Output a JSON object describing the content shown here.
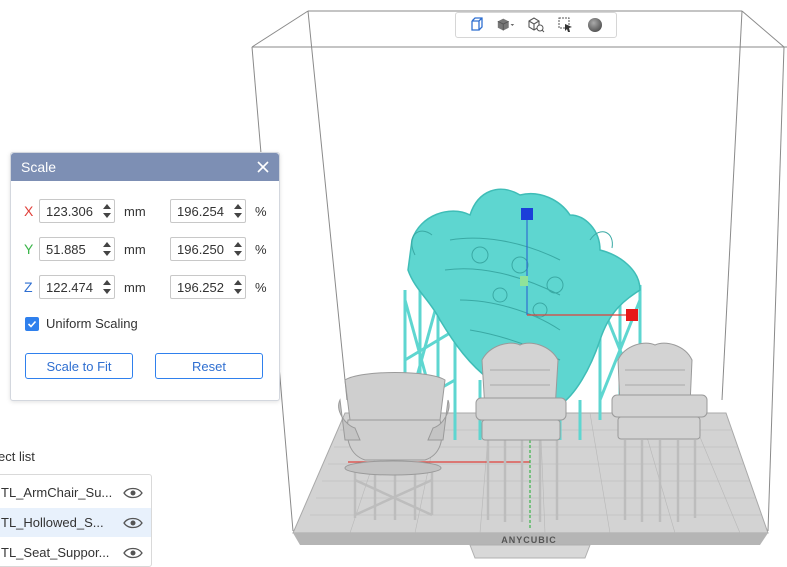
{
  "toolbar": {
    "buttons": [
      {
        "icon": "perspective-cube-icon"
      },
      {
        "icon": "solid-cube-dropdown-icon"
      },
      {
        "icon": "cube-search-icon"
      },
      {
        "icon": "select-cursor-icon"
      },
      {
        "icon": "sphere-icon"
      }
    ]
  },
  "scale_panel": {
    "title": "Scale",
    "rows": [
      {
        "axis": "X",
        "axis_color": "#e0403a",
        "size": "123.306",
        "size_unit": "mm",
        "percent": "196.254",
        "percent_unit": "%"
      },
      {
        "axis": "Y",
        "axis_color": "#3bb54a",
        "size": "51.885",
        "size_unit": "mm",
        "percent": "196.250",
        "percent_unit": "%"
      },
      {
        "axis": "Z",
        "axis_color": "#2f6fd1",
        "size": "122.474",
        "size_unit": "mm",
        "percent": "196.252",
        "percent_unit": "%"
      }
    ],
    "uniform_scaling": {
      "label": "Uniform Scaling",
      "checked": true
    },
    "scale_to_fit_label": "Scale to Fit",
    "reset_label": "Reset"
  },
  "object_list": {
    "title": "ect list",
    "items": [
      {
        "name": "TL_ArmChair_Su...",
        "selected": false
      },
      {
        "name": "TL_Hollowed_S...",
        "selected": true
      },
      {
        "name": "TL_Seat_Suppor...",
        "selected": false
      }
    ]
  },
  "build_plate": {
    "brand": "ANYCUBIC"
  },
  "colors": {
    "model_selected": "#5ed6d0",
    "model": "#c8c8c8",
    "header": "#7d8fb4",
    "accent": "#2f80ed"
  }
}
